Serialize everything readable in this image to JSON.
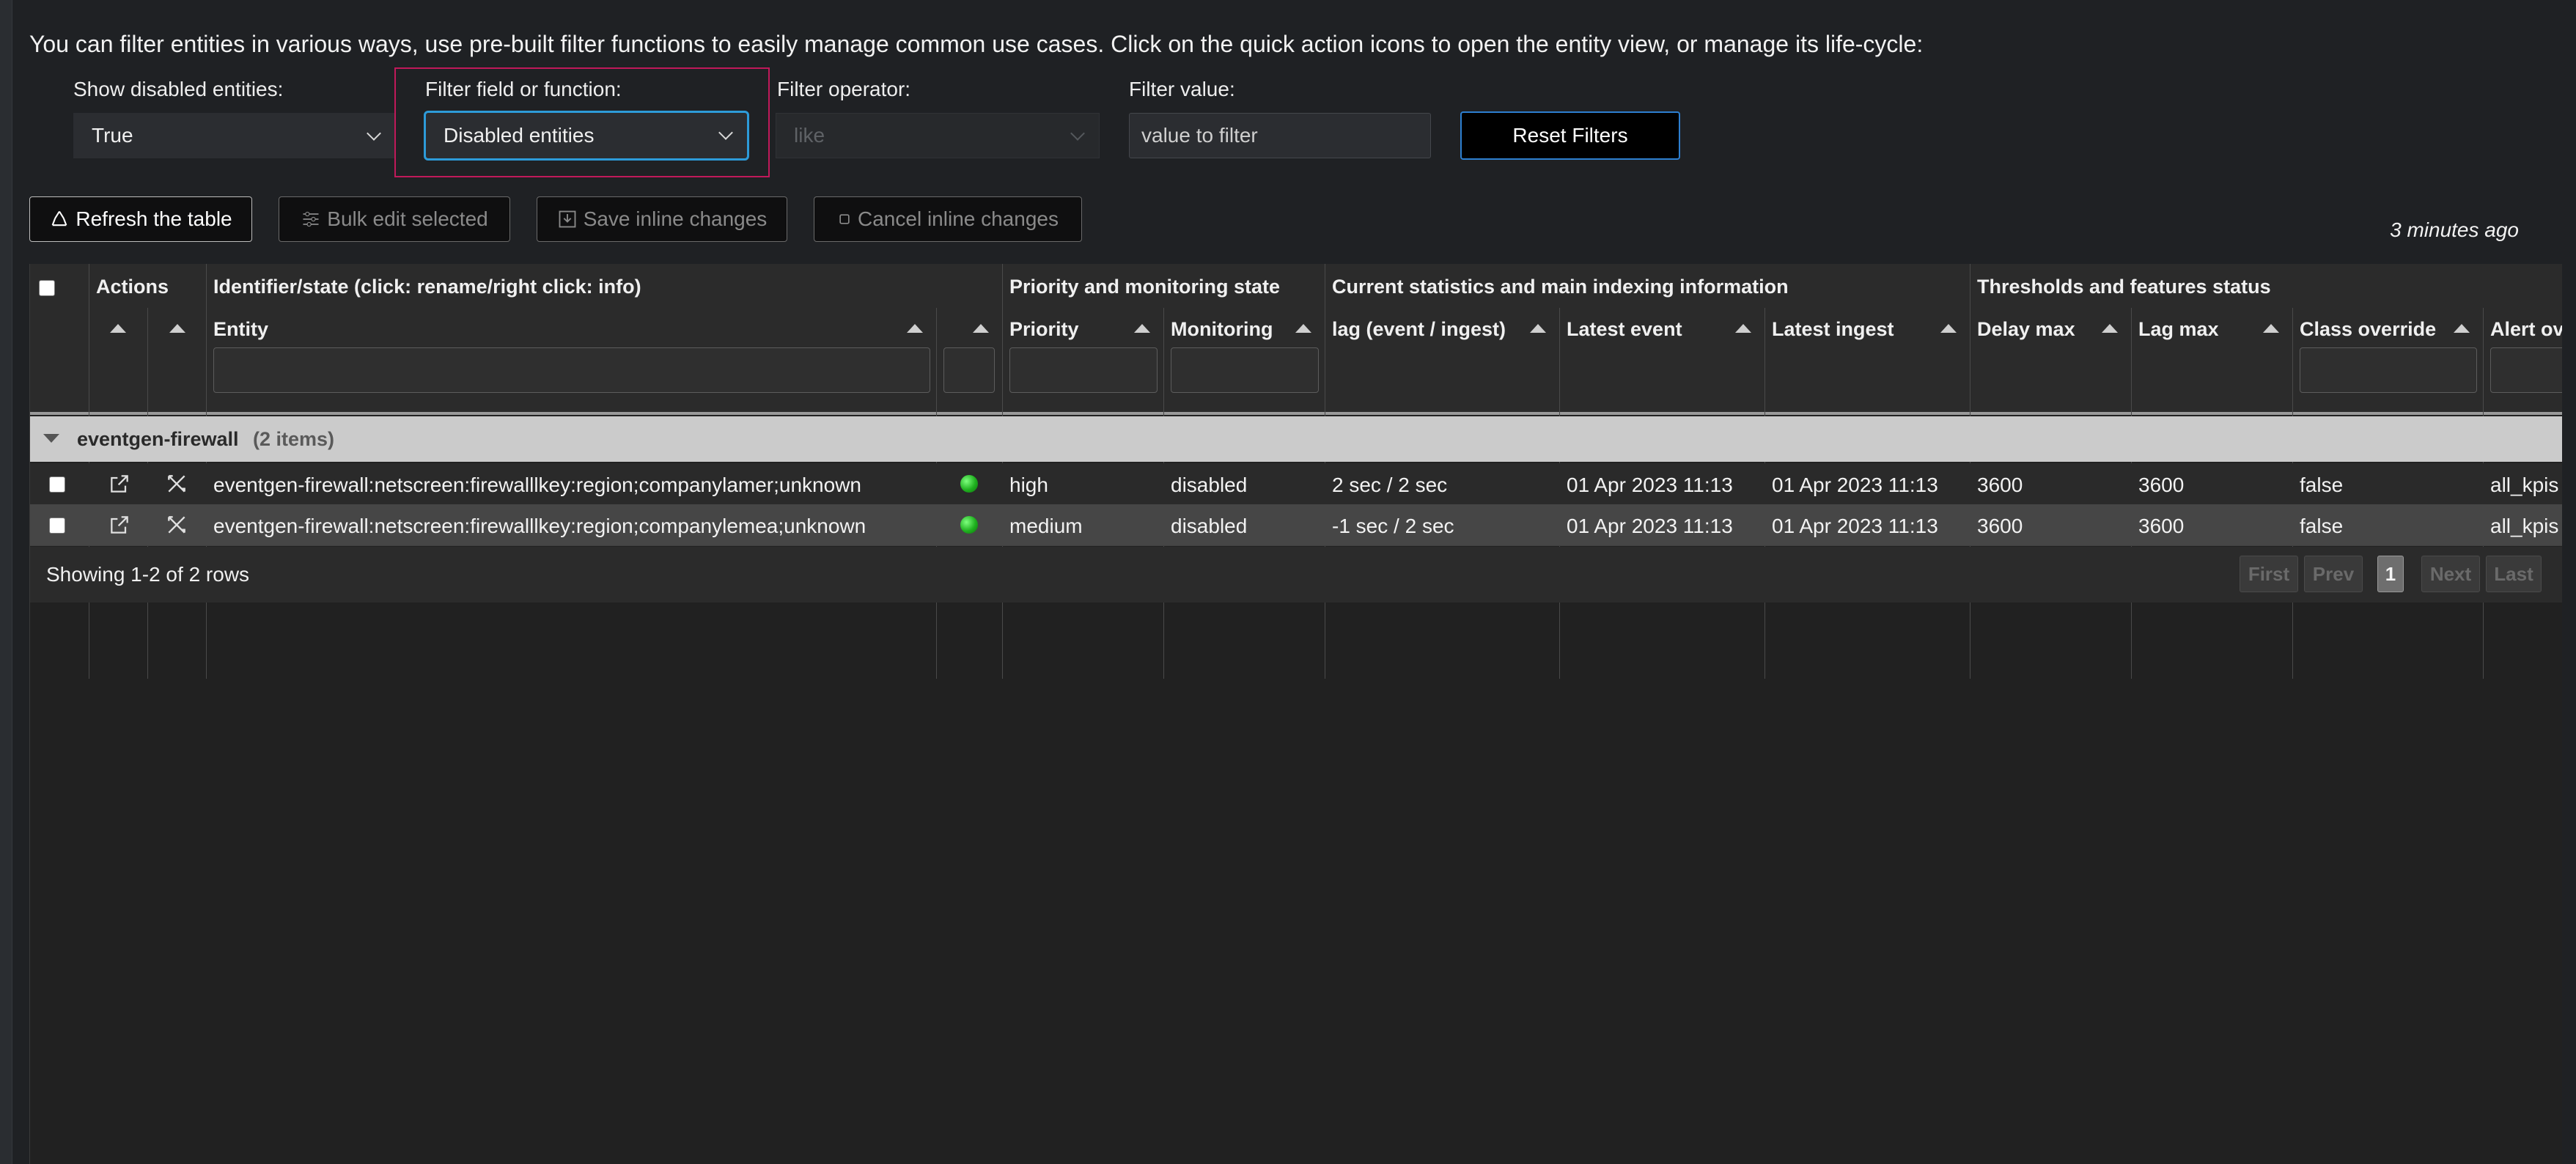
{
  "intro_text": "You can filter entities in various ways, use pre-built filter functions to easily manage common use cases. Click on the quick action icons to open the entity view, or manage its life-cycle:",
  "filters": {
    "show_disabled": {
      "label": "Show disabled entities:",
      "value": "True"
    },
    "field": {
      "label": "Filter field or function:",
      "value": "Disabled entities"
    },
    "operator": {
      "label": "Filter operator:",
      "value": "like"
    },
    "value": {
      "label": "Filter value:",
      "placeholder": "value to filter"
    },
    "reset_label": "Reset Filters"
  },
  "toolbar": {
    "refresh": "Refresh the table",
    "bulk_edit": "Bulk edit selected",
    "save_inline": "Save inline changes",
    "cancel_inline": "Cancel inline changes",
    "last_updated": "3 minutes ago"
  },
  "table": {
    "group_headers": {
      "actions": "Actions",
      "identifier": "Identifier/state (click: rename/right click: info)",
      "priority": "Priority and monitoring state",
      "stats": "Current statistics and main indexing information",
      "thresholds": "Thresholds and features status"
    },
    "columns": {
      "entity": "Entity",
      "priority": "Priority",
      "monitoring": "Monitoring",
      "lag": "lag (event / ingest)",
      "latest_event": "Latest event",
      "latest_ingest": "Latest ingest",
      "delay_max": "Delay max",
      "lag_max": "Lag max",
      "class_override": "Class override",
      "alert_override": "Alert ov"
    },
    "group": {
      "name": "eventgen-firewall",
      "count": "(2 items)"
    },
    "rows": [
      {
        "entity": "eventgen-firewall:netscreen:firewalllkey:region;companylamer;unknown",
        "state_color": "#22c022",
        "priority": "high",
        "monitoring": "disabled",
        "lag": "2 sec / 2 sec",
        "latest_event": "01 Apr 2023 11:13",
        "latest_ingest": "01 Apr 2023 11:13",
        "delay_max": "3600",
        "lag_max": "3600",
        "class_override": "false",
        "alert_override": "all_kpis"
      },
      {
        "entity": "eventgen-firewall:netscreen:firewalllkey:region;companylemea;unknown",
        "state_color": "#22c022",
        "priority": "medium",
        "monitoring": "disabled",
        "lag": "-1 sec / 2 sec",
        "latest_event": "01 Apr 2023 11:13",
        "latest_ingest": "01 Apr 2023 11:13",
        "delay_max": "3600",
        "lag_max": "3600",
        "class_override": "false",
        "alert_override": "all_kpis"
      }
    ],
    "footer": {
      "showing": "Showing 1-2 of 2 rows"
    },
    "pagination": {
      "first": "First",
      "prev": "Prev",
      "current": "1",
      "next": "Next",
      "last": "Last"
    }
  }
}
